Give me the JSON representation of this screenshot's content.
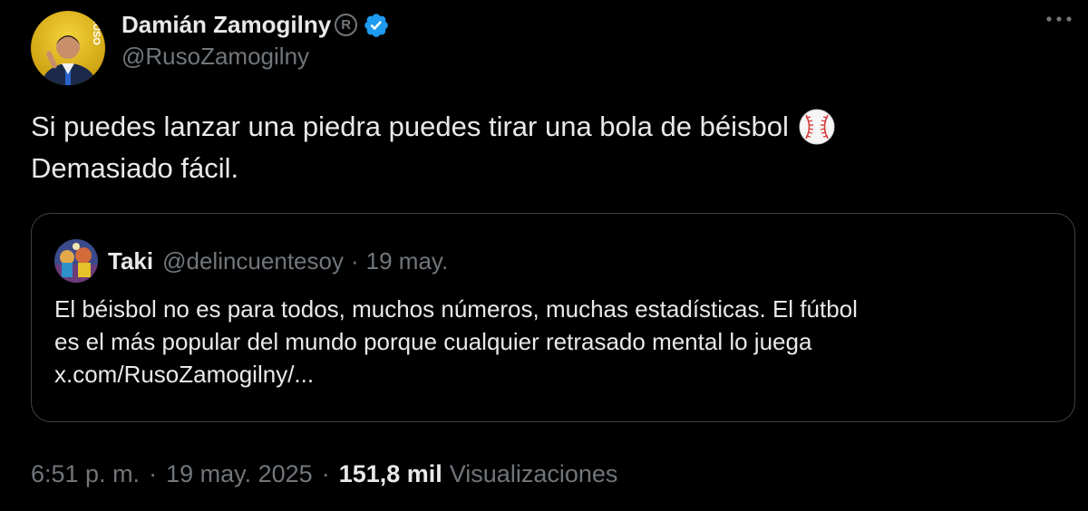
{
  "tweet": {
    "author_name": "Damián Zamogilny",
    "author_handle": "@RusoZamogilny",
    "registered_mark": "R",
    "avatar_badge": "RUSO",
    "text_lines": [
      "Si puedes lanzar una piedra puedes tirar una bola de béisbol",
      "Demasiado fácil."
    ],
    "emoji_icon": "baseball-icon",
    "more_icon": "more-horizontal-icon",
    "accent_verified": "#1d9bf0",
    "time": "6:51 p. m.",
    "separator": "·",
    "date": "19 may. 2025",
    "views_count": "151,8 mil",
    "views_label": "Visualizaciones"
  },
  "quote": {
    "author_name": "Taki",
    "author_handle": "@delincuentesoy",
    "separator": "·",
    "date": "19 may.",
    "text_lines": [
      "El béisbol no es para todos,  muchos números, muchas estadísticas. El fútbol",
      "es el más popular del mundo porque cualquier retrasado mental lo juega",
      "x.com/RusoZamogilny/..."
    ]
  },
  "colors": {
    "background": "#000000",
    "text_primary": "#e7e9ea",
    "text_secondary": "#71767b",
    "border": "#3e4144"
  }
}
